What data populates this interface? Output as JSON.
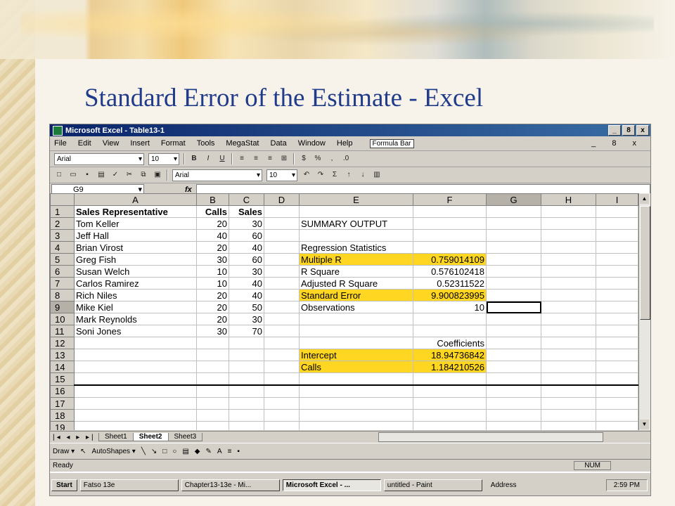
{
  "slide": {
    "title": "Standard Error of the Estimate - Excel"
  },
  "window": {
    "title": "Microsoft Excel - Table13-1",
    "buttons": [
      "_",
      "8",
      "x"
    ],
    "menu": [
      "File",
      "Edit",
      "View",
      "Insert",
      "Format",
      "Tools",
      "MegaStat",
      "Data",
      "Window",
      "Help"
    ],
    "formula_bar_button": "Formula Bar",
    "menu_right": "_ 8 x"
  },
  "toolbar": {
    "font": "Arial",
    "size": "10",
    "font2": "Arial",
    "size2": "10",
    "icons": [
      "B",
      "I",
      "U",
      "%",
      ",",
      ".0",
      "Σ"
    ]
  },
  "namebox": {
    "value": "G9",
    "fx": "fx"
  },
  "columns": [
    "A",
    "B",
    "C",
    "D",
    "E",
    "F",
    "G",
    "H",
    "I"
  ],
  "rows": [
    {
      "n": "1",
      "a": "Sales Representative",
      "b": "Calls",
      "c": "Sales",
      "e": "",
      "f": ""
    },
    {
      "n": "2",
      "a": "Tom Keller",
      "b": "20",
      "c": "30",
      "e": "SUMMARY OUTPUT",
      "f": ""
    },
    {
      "n": "3",
      "a": "Jeff Hall",
      "b": "40",
      "c": "60",
      "e": "",
      "f": ""
    },
    {
      "n": "4",
      "a": "Brian Virost",
      "b": "20",
      "c": "40",
      "e": "Regression Statistics",
      "f": ""
    },
    {
      "n": "5",
      "a": "Greg Fish",
      "b": "30",
      "c": "60",
      "e": "Multiple R",
      "f": "0.759014109"
    },
    {
      "n": "6",
      "a": "Susan Welch",
      "b": "10",
      "c": "30",
      "e": "R Square",
      "f": "0.576102418"
    },
    {
      "n": "7",
      "a": "Carlos Ramirez",
      "b": "10",
      "c": "40",
      "e": "Adjusted R Square",
      "f": "0.52311522"
    },
    {
      "n": "8",
      "a": "Rich Niles",
      "b": "20",
      "c": "40",
      "e": "Standard Error",
      "f": "9.900823995"
    },
    {
      "n": "9",
      "a": "Mike Kiel",
      "b": "20",
      "c": "50",
      "e": "Observations",
      "f": "10"
    },
    {
      "n": "10",
      "a": "Mark Reynolds",
      "b": "20",
      "c": "30",
      "e": "",
      "f": ""
    },
    {
      "n": "11",
      "a": "Soni Jones",
      "b": "30",
      "c": "70",
      "e": "",
      "f": ""
    },
    {
      "n": "12",
      "a": "",
      "b": "",
      "c": "",
      "e": "",
      "f": "Coefficients"
    },
    {
      "n": "13",
      "a": "",
      "b": "",
      "c": "",
      "e": "Intercept",
      "f": "18.94736842"
    },
    {
      "n": "14",
      "a": "",
      "b": "",
      "c": "",
      "e": "Calls",
      "f": "1.184210526"
    },
    {
      "n": "15",
      "a": "",
      "b": "",
      "c": "",
      "e": "",
      "f": ""
    },
    {
      "n": "16",
      "a": "",
      "b": "",
      "c": "",
      "e": "",
      "f": ""
    },
    {
      "n": "17",
      "a": "",
      "b": "",
      "c": "",
      "e": "",
      "f": ""
    },
    {
      "n": "18",
      "a": "",
      "b": "",
      "c": "",
      "e": "",
      "f": ""
    },
    {
      "n": "19",
      "a": "",
      "b": "",
      "c": "",
      "e": "",
      "f": ""
    }
  ],
  "highlight_color": "#ffd622",
  "tabs": {
    "nav": "|◂ ◂ ▸ ▸|",
    "sheets": [
      "Sheet1",
      "Sheet2",
      "Sheet3"
    ],
    "active": "Sheet2"
  },
  "drawbar": {
    "draw": "Draw ▾",
    "autoshapes": "AutoShapes ▾"
  },
  "status": {
    "left": "Ready",
    "num": "NUM"
  },
  "taskbar": {
    "start": "Start",
    "tasks": [
      "Fatso 13e",
      "Chapter13-13e - Mi...",
      "Microsoft Excel - ...",
      "untitled - Paint"
    ],
    "address": "Address",
    "time": "2:59 PM"
  }
}
